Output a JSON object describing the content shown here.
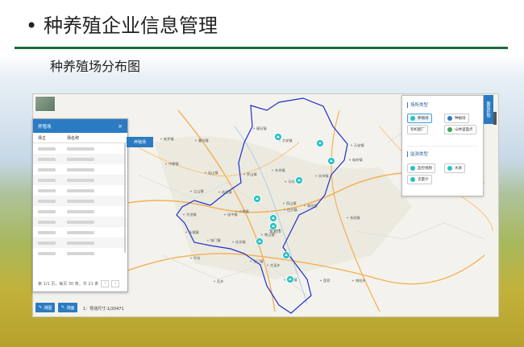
{
  "slide": {
    "bullet": "•",
    "title": "种养殖企业信息管理",
    "subtitle": "种养殖场分布图"
  },
  "panel": {
    "title": "养殖场",
    "close": "×",
    "columns": [
      "场主",
      "场名称"
    ],
    "pager": "第 1/1 页，每页 30 条，共 21 条"
  },
  "tab_label": "养殖场",
  "buttons": {
    "btn1": "测图",
    "btn2": "测面"
  },
  "scale_text": "1：导测尺寸:1/20471",
  "legend": {
    "section1": "场所类型",
    "types": [
      "养殖场",
      "种植场",
      "有机肥厂",
      "山林里面点"
    ],
    "section2": "监测类型",
    "monitors": [
      "监控视频",
      "水质",
      "流量计"
    ]
  },
  "side_tab": "图层控制",
  "map": {
    "city": "龙岩市",
    "towns": [
      "大安镇",
      "新罗镇",
      "曹坑镇",
      "岩山镇",
      "苏坂镇",
      "适中镇",
      "罗山镇",
      "江山镇",
      "小池镇",
      "红坊镇",
      "铁山镇",
      "东肖镇",
      "白沙镇",
      "大池镇",
      "雁石镇",
      "万安镇",
      "坎市镇",
      "龙门镇",
      "西山镇",
      "湖坑镇",
      "岐岭镇",
      "下洋镇",
      "大溪乡",
      "中都镇",
      "永福镇",
      "坪坊",
      "马坑",
      "城门镇",
      "东阳镇",
      "南阳乡",
      "莲荷",
      "吾乡"
    ]
  },
  "colors": {
    "accent": "#2a7bc1",
    "rule": "#1d6b3a",
    "boundary": "#1a2fd0",
    "marker": "#27c2c8"
  }
}
